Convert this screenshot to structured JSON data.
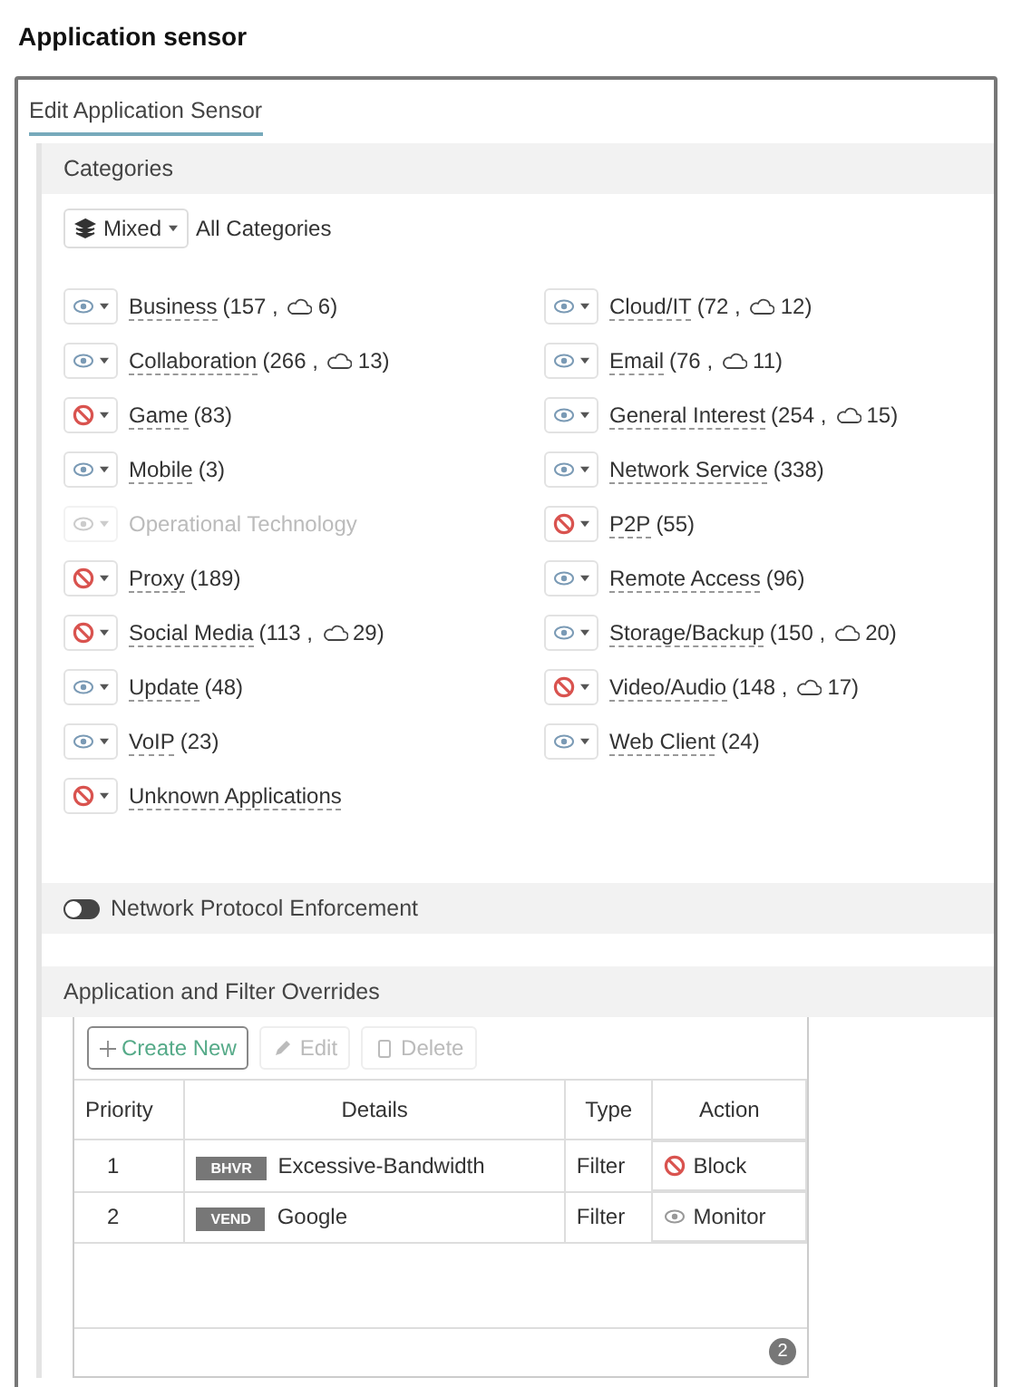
{
  "page_title": "Application sensor",
  "tab": {
    "label": "Edit Application Sensor",
    "selected": true
  },
  "categories": {
    "title": "Categories",
    "mixed_button": "Mixed",
    "all_label": "All Categories",
    "items": [
      {
        "name": "Business",
        "count": "(157 ,",
        "cloud_count": "6)",
        "kind": "monitor",
        "disabled": false
      },
      {
        "name": "Cloud/IT",
        "count": "(72 ,",
        "cloud_count": "12)",
        "kind": "monitor",
        "disabled": false
      },
      {
        "name": "Collaboration",
        "count": "(266 ,",
        "cloud_count": "13)",
        "kind": "monitor",
        "disabled": false
      },
      {
        "name": "Email",
        "count": "(76 ,",
        "cloud_count": "11)",
        "kind": "monitor",
        "disabled": false
      },
      {
        "name": "Game",
        "count": "(83)",
        "kind": "block",
        "disabled": false
      },
      {
        "name": "General Interest",
        "count": "(254 ,",
        "cloud_count": "15)",
        "kind": "monitor",
        "disabled": false
      },
      {
        "name": "Mobile",
        "count": "(3)",
        "kind": "monitor",
        "disabled": false
      },
      {
        "name": "Network Service",
        "count": "(338)",
        "kind": "monitor",
        "disabled": false
      },
      {
        "name": "Operational Technology",
        "kind": "monitor",
        "disabled": true
      },
      {
        "name": "P2P",
        "count": "(55)",
        "kind": "block",
        "disabled": false
      },
      {
        "name": "Proxy",
        "count": "(189)",
        "kind": "block",
        "disabled": false
      },
      {
        "name": "Remote Access",
        "count": "(96)",
        "kind": "monitor",
        "disabled": false
      },
      {
        "name": "Social Media",
        "count": "(113 ,",
        "cloud_count": "29)",
        "kind": "block",
        "disabled": false
      },
      {
        "name": "Storage/Backup",
        "count": "(150 ,",
        "cloud_count": "20)",
        "kind": "monitor",
        "disabled": false
      },
      {
        "name": "Update",
        "count": "(48)",
        "kind": "monitor",
        "disabled": false
      },
      {
        "name": "Video/Audio",
        "count": "(148 ,",
        "cloud_count": "17)",
        "kind": "block",
        "disabled": false
      },
      {
        "name": "VoIP",
        "count": "(23)",
        "kind": "monitor",
        "disabled": false
      },
      {
        "name": "Web Client",
        "count": "(24)",
        "kind": "monitor",
        "disabled": false
      },
      {
        "name": "Unknown Applications",
        "kind": "block",
        "disabled": false
      }
    ]
  },
  "protocol_enforcement": {
    "label": "Network Protocol Enforcement",
    "on": false
  },
  "overrides": {
    "title": "Application and Filter Overrides",
    "toolbar": [
      {
        "label": "Create New",
        "kind": "create",
        "disabled": false
      },
      {
        "label": "Edit",
        "kind": "edit",
        "disabled": true
      },
      {
        "label": "Delete",
        "kind": "delete",
        "disabled": true
      }
    ],
    "columns": [
      "Priority",
      "Details",
      "Type",
      "Action"
    ],
    "rows": [
      {
        "priority": "1",
        "tag": "BHVR",
        "details": "Excessive-Bandwidth",
        "type": "Filter",
        "kind": "block",
        "action_label": "Block"
      },
      {
        "priority": "2",
        "tag": "VEND",
        "details": "Google",
        "type": "Filter",
        "kind": "monitor",
        "action_label": "Monitor"
      }
    ],
    "count": "2"
  }
}
